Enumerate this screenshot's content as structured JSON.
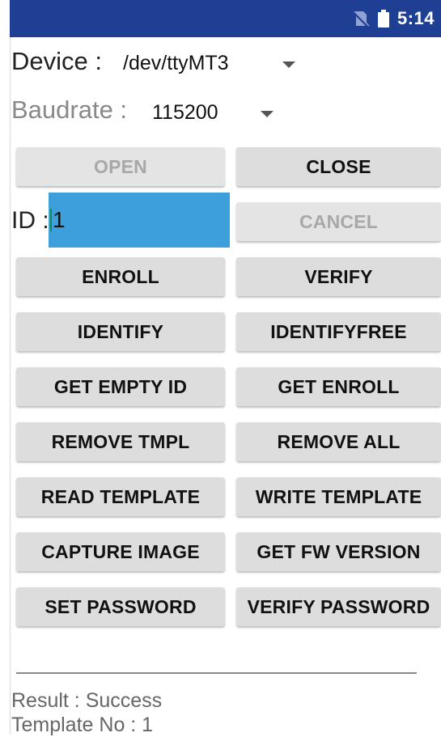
{
  "status_bar": {
    "time": "5:14",
    "icons": [
      "no-sim-icon",
      "battery-icon"
    ],
    "background": "#1f3f94"
  },
  "device": {
    "label": "Device :",
    "value": "/dev/ttyMT3"
  },
  "baudrate": {
    "label": "Baudrate :",
    "value": "115200"
  },
  "id_field": {
    "label": "ID :",
    "value": "1"
  },
  "buttons": {
    "open": "OPEN",
    "close": "CLOSE",
    "cancel": "CANCEL",
    "enroll": "ENROLL",
    "verify": "VERIFY",
    "identify": "IDENTIFY",
    "identifyfree": "IDENTIFYFREE",
    "get_empty_id": "GET EMPTY ID",
    "get_enroll": "GET ENROLL",
    "remove_tmpl": "REMOVE TMPL",
    "remove_all": "REMOVE ALL",
    "read_template": "READ TEMPLATE",
    "write_template": "WRITE TEMPLATE",
    "capture_image": "CAPTURE IMAGE",
    "get_fw_version": "GET FW VERSION",
    "set_password": "SET PASSWORD",
    "verify_password": "VERIFY PASSWORD"
  },
  "output": {
    "result": "Result : Success",
    "template_no": "Template No : 1"
  },
  "colors": {
    "accent": "#3d9fdc",
    "button": "#dddddd"
  }
}
